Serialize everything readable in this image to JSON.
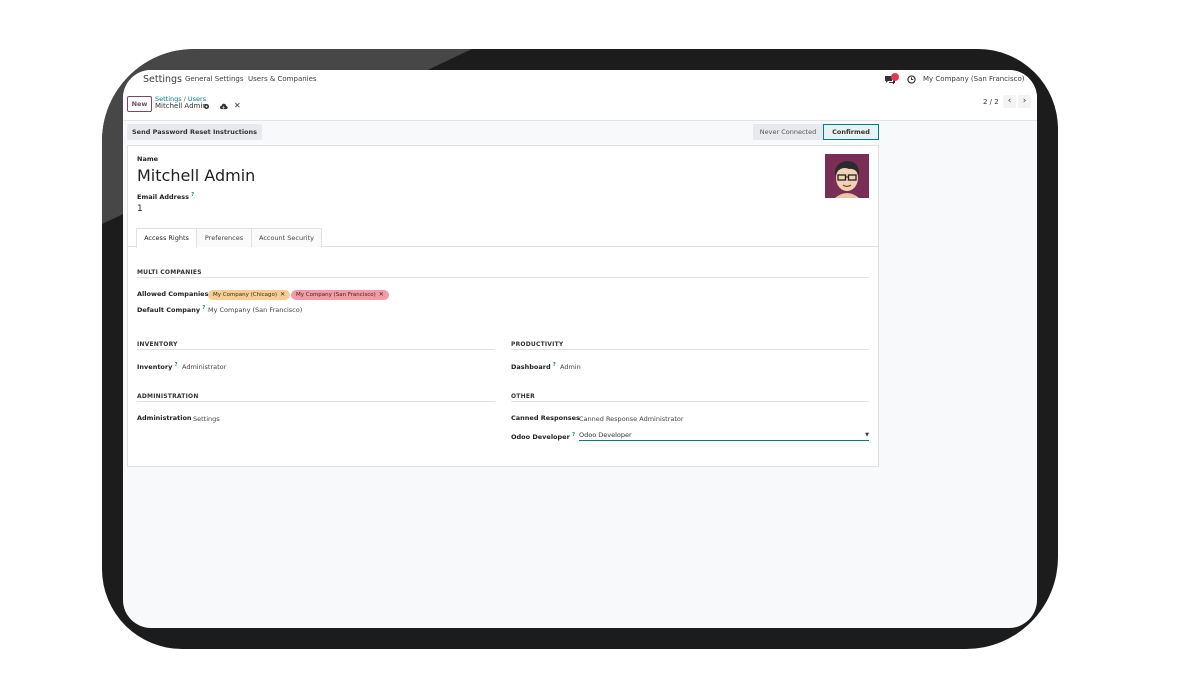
{
  "navbar": {
    "app_name": "Settings",
    "menu": [
      "General Settings",
      "Users & Companies"
    ],
    "chat_badge": "",
    "company": "My Company (San Francisco)"
  },
  "control": {
    "new_label": "New",
    "breadcrumb": [
      "Settings",
      "Users"
    ],
    "record_name": "Mitchell Admin",
    "pager": "2 / 2"
  },
  "status": {
    "reset_button": "Send Password Reset Instructions",
    "stages": [
      "Never Connected",
      "Confirmed"
    ],
    "active_stage": "Confirmed"
  },
  "form": {
    "name_label": "Name",
    "name": "Mitchell Admin",
    "email_label": "Email Address",
    "email_value": "1",
    "tabs": [
      "Access Rights",
      "Preferences",
      "Account Security"
    ],
    "multi_companies": {
      "title": "MULTI COMPANIES",
      "allowed_label": "Allowed Companies",
      "allowed_tags": [
        {
          "label": "My Company (Chicago)",
          "color": "#f7cd93"
        },
        {
          "label": "My Company (San Francisco)",
          "color": "#f59aa9"
        }
      ],
      "default_label": "Default Company",
      "default_value": "My Company (San Francisco)"
    },
    "inventory": {
      "title": "INVENTORY",
      "label": "Inventory",
      "value": "Administrator"
    },
    "productivity": {
      "title": "PRODUCTIVITY",
      "label": "Dashboard",
      "value": "Admin"
    },
    "administration": {
      "title": "ADMINISTRATION",
      "label": "Administration",
      "value": "Settings"
    },
    "other": {
      "title": "OTHER",
      "canned_label": "Canned Responses",
      "canned_value": "Canned Response Administrator",
      "developer_label": "Odoo Developer",
      "developer_value": "Odoo Developer"
    }
  },
  "colors": {
    "accent": "#017e84",
    "brand": "#714b67",
    "badge": "#e53950"
  }
}
